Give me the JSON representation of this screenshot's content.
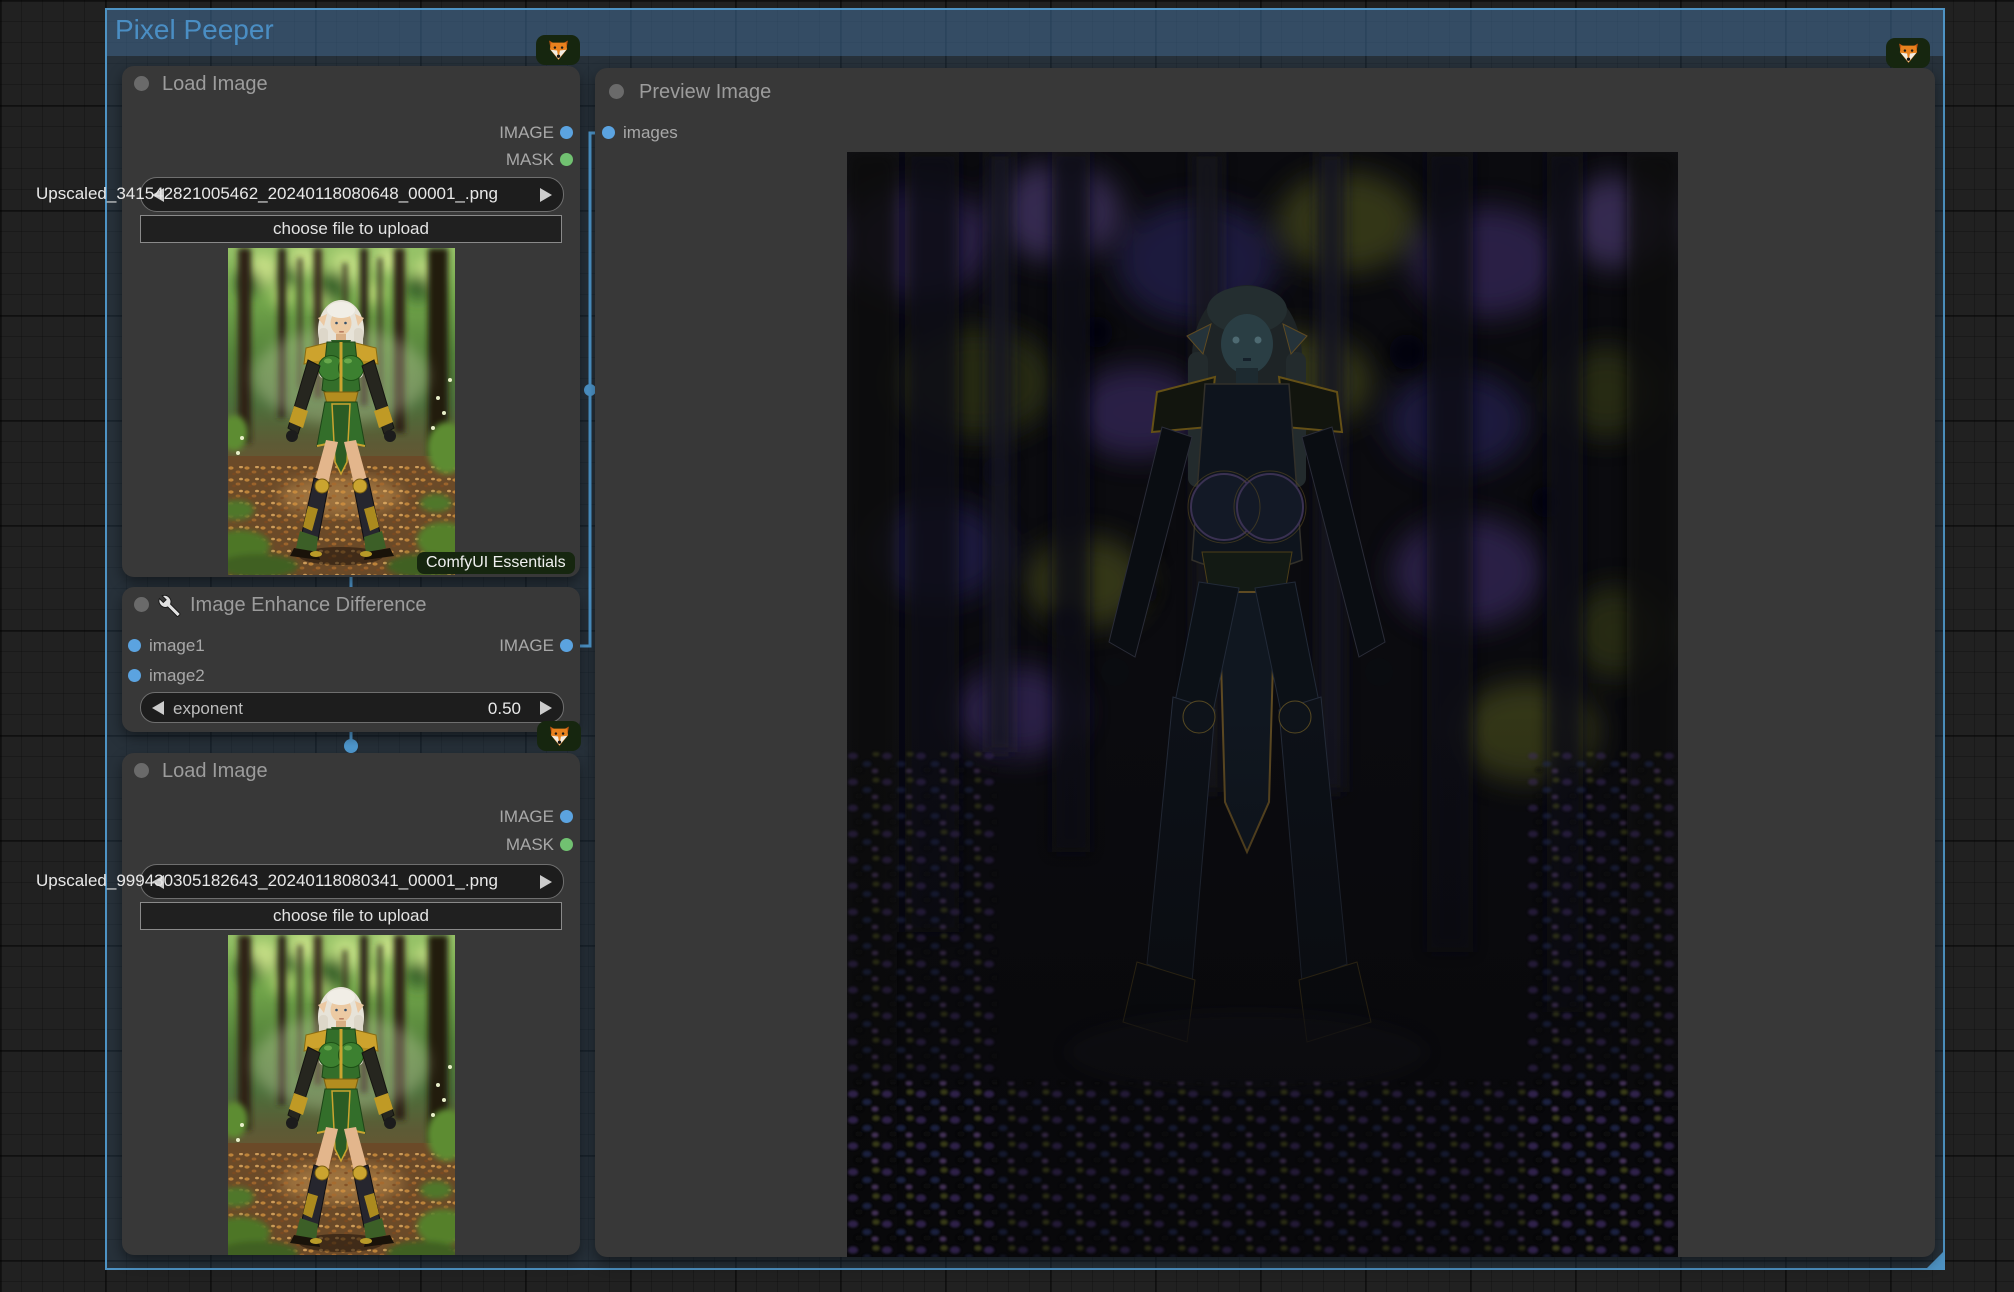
{
  "group": {
    "title": "Pixel Peeper"
  },
  "nodes": {
    "load1": {
      "title": "Load Image",
      "outputs": {
        "image": "IMAGE",
        "mask": "MASK"
      },
      "filename": "Upscaled_341542821005462_20240118080648_00001_.png",
      "upload_button": "choose file to upload"
    },
    "enhance": {
      "title": "Image Enhance Difference",
      "inputs": {
        "image1": "image1",
        "image2": "image2"
      },
      "outputs": {
        "image": "IMAGE"
      },
      "widgets": {
        "exponent": {
          "label": "exponent",
          "value": "0.50"
        }
      },
      "pack_badge": "ComfyUI Essentials"
    },
    "load2": {
      "title": "Load Image",
      "outputs": {
        "image": "IMAGE",
        "mask": "MASK"
      },
      "filename": "Upscaled_999430305182643_20240118080341_00001_.png",
      "upload_button": "choose file to upload"
    },
    "preview": {
      "title": "Preview Image",
      "inputs": {
        "images": "images"
      }
    }
  },
  "icons": {
    "fox_badge": "fox-logo-icon",
    "wrench": "wrench-icon",
    "collapse_dot": "collapse-dot"
  },
  "colors": {
    "group_border": "#4e93c4",
    "group_title_text": "#4a8ec4",
    "link": "#529ed6",
    "port_image": "#5ba3e0",
    "port_mask": "#71c171",
    "badge_bg": "#16260f",
    "node_bg": "#383838"
  }
}
